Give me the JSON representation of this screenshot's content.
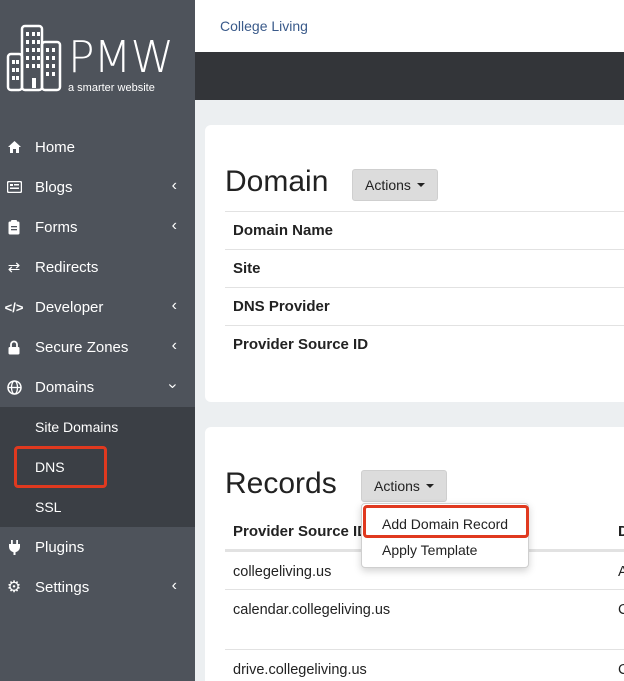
{
  "brand": {
    "name": "PMW",
    "tagline": "a smarter website"
  },
  "breadcrumb": "College Living",
  "nav": {
    "items": [
      {
        "label": "Home",
        "icon": "home-icon"
      },
      {
        "label": "Blogs",
        "icon": "blogs-icon"
      },
      {
        "label": "Forms",
        "icon": "forms-icon"
      },
      {
        "label": "Redirects",
        "icon": "redirects-icon"
      },
      {
        "label": "Developer",
        "icon": "code-icon"
      },
      {
        "label": "Secure Zones",
        "icon": "lock-icon"
      },
      {
        "label": "Domains",
        "icon": "globe-icon"
      }
    ],
    "domains_sub": [
      "Site Domains",
      "DNS",
      "SSL"
    ],
    "bottom": [
      {
        "label": "Plugins",
        "icon": "plug-icon"
      },
      {
        "label": "Settings",
        "icon": "gear-icon"
      }
    ]
  },
  "domain_panel": {
    "title": "Domain",
    "actions_label": "Actions",
    "fields": [
      "Domain Name",
      "Site",
      "DNS Provider",
      "Provider Source ID"
    ]
  },
  "records_panel": {
    "title": "Records",
    "actions_label": "Actions",
    "columns": [
      "Provider Source ID",
      "D"
    ],
    "rows": [
      {
        "source": "collegeliving.us",
        "d": "A"
      },
      {
        "source": "calendar.collegeliving.us",
        "d": "C"
      },
      {
        "source": "drive.collegeliving.us",
        "d": "C"
      }
    ],
    "dropdown": [
      "Add Domain Record",
      "Apply Template"
    ]
  },
  "colors": {
    "sidebar": "#4e535b",
    "submenu": "#3b3f45",
    "highlight": "#e0391f",
    "link": "#3a5a8a"
  }
}
